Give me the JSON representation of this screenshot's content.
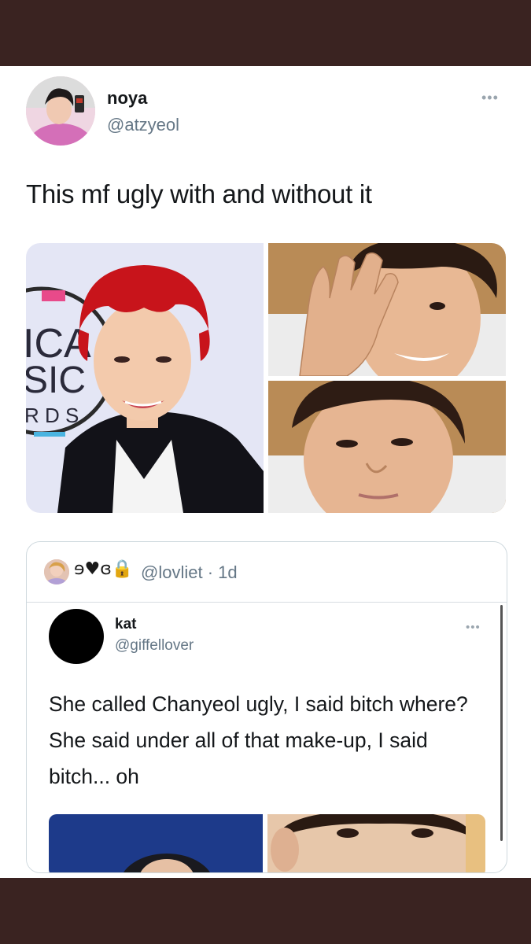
{
  "tweet": {
    "display_name": "noya",
    "handle": "@atzyeol",
    "more_label": "•••",
    "text": "This mf ugly with and without it",
    "photos": [
      {
        "name": "photo-red-hair-event",
        "background_text": [
          "ICA",
          "SIC",
          "R D S"
        ]
      },
      {
        "name": "photo-hand-over-face"
      },
      {
        "name": "photo-lying-in-bed"
      }
    ]
  },
  "quoted": {
    "emoji_name": "ɘ♥ɞ🔒",
    "handle_time": "@lovliet · 1d",
    "inner": {
      "display_name": "kat",
      "handle": "@giffellover",
      "more_label": "•••",
      "text": "She called Chanyeol ugly, I said bitch where? She said under all of that make-up, I said bitch... oh"
    }
  },
  "colors": {
    "frame": "#3a2321",
    "card": "#ffffff",
    "primary_text": "#14171a",
    "secondary_text": "#657786"
  }
}
